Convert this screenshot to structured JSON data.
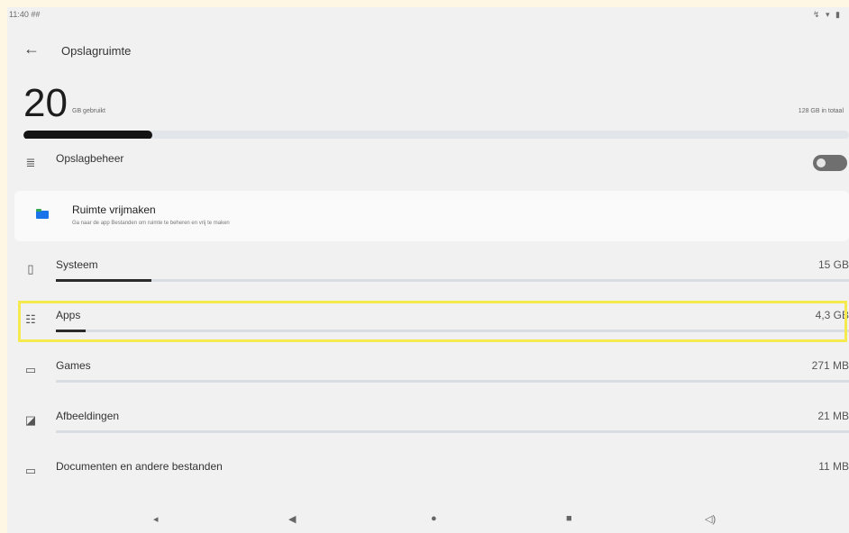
{
  "status_bar": {
    "time": "11:40 ##",
    "icons": "↯ ▾ ▮"
  },
  "header": {
    "title": "Opslagruimte",
    "back_icon": "←"
  },
  "summary": {
    "used_value": "20",
    "used_label": "GB gebruikt",
    "total_label": "128 GB in totaal",
    "used_fraction": 0.156
  },
  "storage_manager": {
    "label": "Opslagbeheer",
    "icon": "≣",
    "enabled": false
  },
  "free_space_card": {
    "title": "Ruimte vrijmaken",
    "subtitle": "Ga naar de app Bestanden om ruimte te beheren en vrij te maken",
    "icon": "folder-icon"
  },
  "categories": [
    {
      "label": "Systeem",
      "value": "15 GB",
      "icon": "▯",
      "fraction": 0.12
    },
    {
      "label": "Apps",
      "value": "4,3 GB",
      "icon": "☷",
      "fraction": 0.037
    },
    {
      "label": "Games",
      "value": "271 MB",
      "icon": "▭",
      "fraction": 0.0
    },
    {
      "label": "Afbeeldingen",
      "value": "21 MB",
      "icon": "◪",
      "fraction": 0.0
    },
    {
      "label": "Documenten en andere bestanden",
      "value": "11 MB",
      "icon": "▭",
      "fraction": 0.0
    }
  ],
  "nav_bar": {
    "items": [
      "◂",
      "◀",
      "●",
      "■",
      "◁)"
    ]
  },
  "colors": {
    "highlight": "#f4ea4f",
    "bar_fill": "#141414",
    "bar_track": "#e2e6ea"
  }
}
